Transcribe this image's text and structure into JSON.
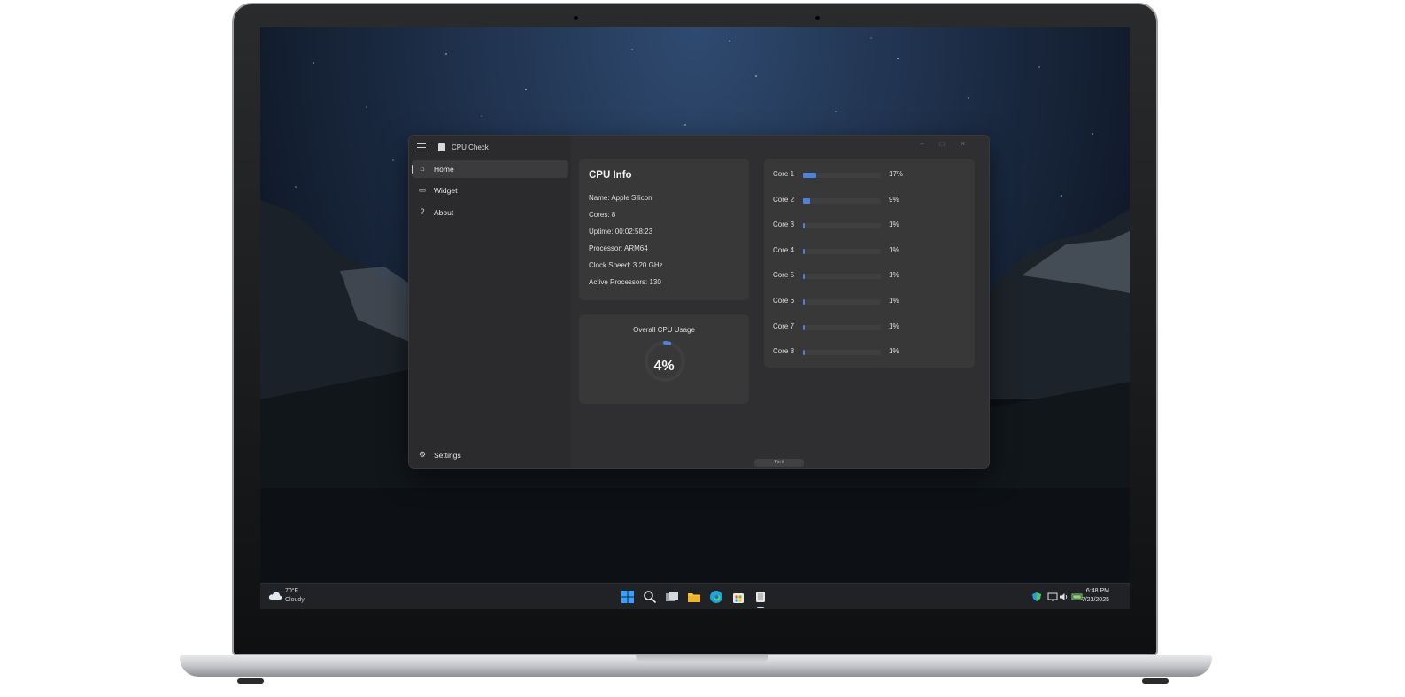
{
  "app": {
    "title": "CPU Check",
    "nav": [
      {
        "label": "Home",
        "icon": "home-icon",
        "active": true
      },
      {
        "label": "Widget",
        "icon": "widget-icon",
        "active": false
      },
      {
        "label": "About",
        "icon": "help-icon",
        "active": false
      }
    ],
    "settings_label": "Settings",
    "cpu_info": {
      "title": "CPU Info",
      "lines": [
        "Name: Apple Silicon",
        "Cores: 8",
        "Uptime: 00:02:58:23",
        "Processor: ARM64",
        "Clock Speed: 3.20 GHz",
        "Active Processors: 130"
      ]
    },
    "overall": {
      "label": "Overall CPU Usage",
      "value_text": "4%",
      "fraction": 0.04
    },
    "cores": [
      {
        "name": "Core 1",
        "pct_text": "17%",
        "fraction": 0.17
      },
      {
        "name": "Core 2",
        "pct_text": "9%",
        "fraction": 0.09
      },
      {
        "name": "Core 3",
        "pct_text": "1%",
        "fraction": 0.01
      },
      {
        "name": "Core 4",
        "pct_text": "1%",
        "fraction": 0.01
      },
      {
        "name": "Core 5",
        "pct_text": "1%",
        "fraction": 0.01
      },
      {
        "name": "Core 6",
        "pct_text": "1%",
        "fraction": 0.01
      },
      {
        "name": "Core 7",
        "pct_text": "1%",
        "fraction": 0.01
      },
      {
        "name": "Core 8",
        "pct_text": "1%",
        "fraction": 0.01
      }
    ],
    "pin_label": "Pin it",
    "accent": "#4f82d8"
  },
  "taskbar": {
    "weather_temp": "70°F",
    "weather_condition": "Cloudy",
    "time": "6:48 PM",
    "date": "7/23/2025",
    "apps": [
      "start-icon",
      "search-icon",
      "task-view-icon",
      "file-explorer-icon",
      "edge-icon",
      "store-icon",
      "cpu-check-icon"
    ],
    "tray": [
      "defender-icon",
      "network-icon",
      "volume-icon",
      "battery-icon"
    ]
  }
}
